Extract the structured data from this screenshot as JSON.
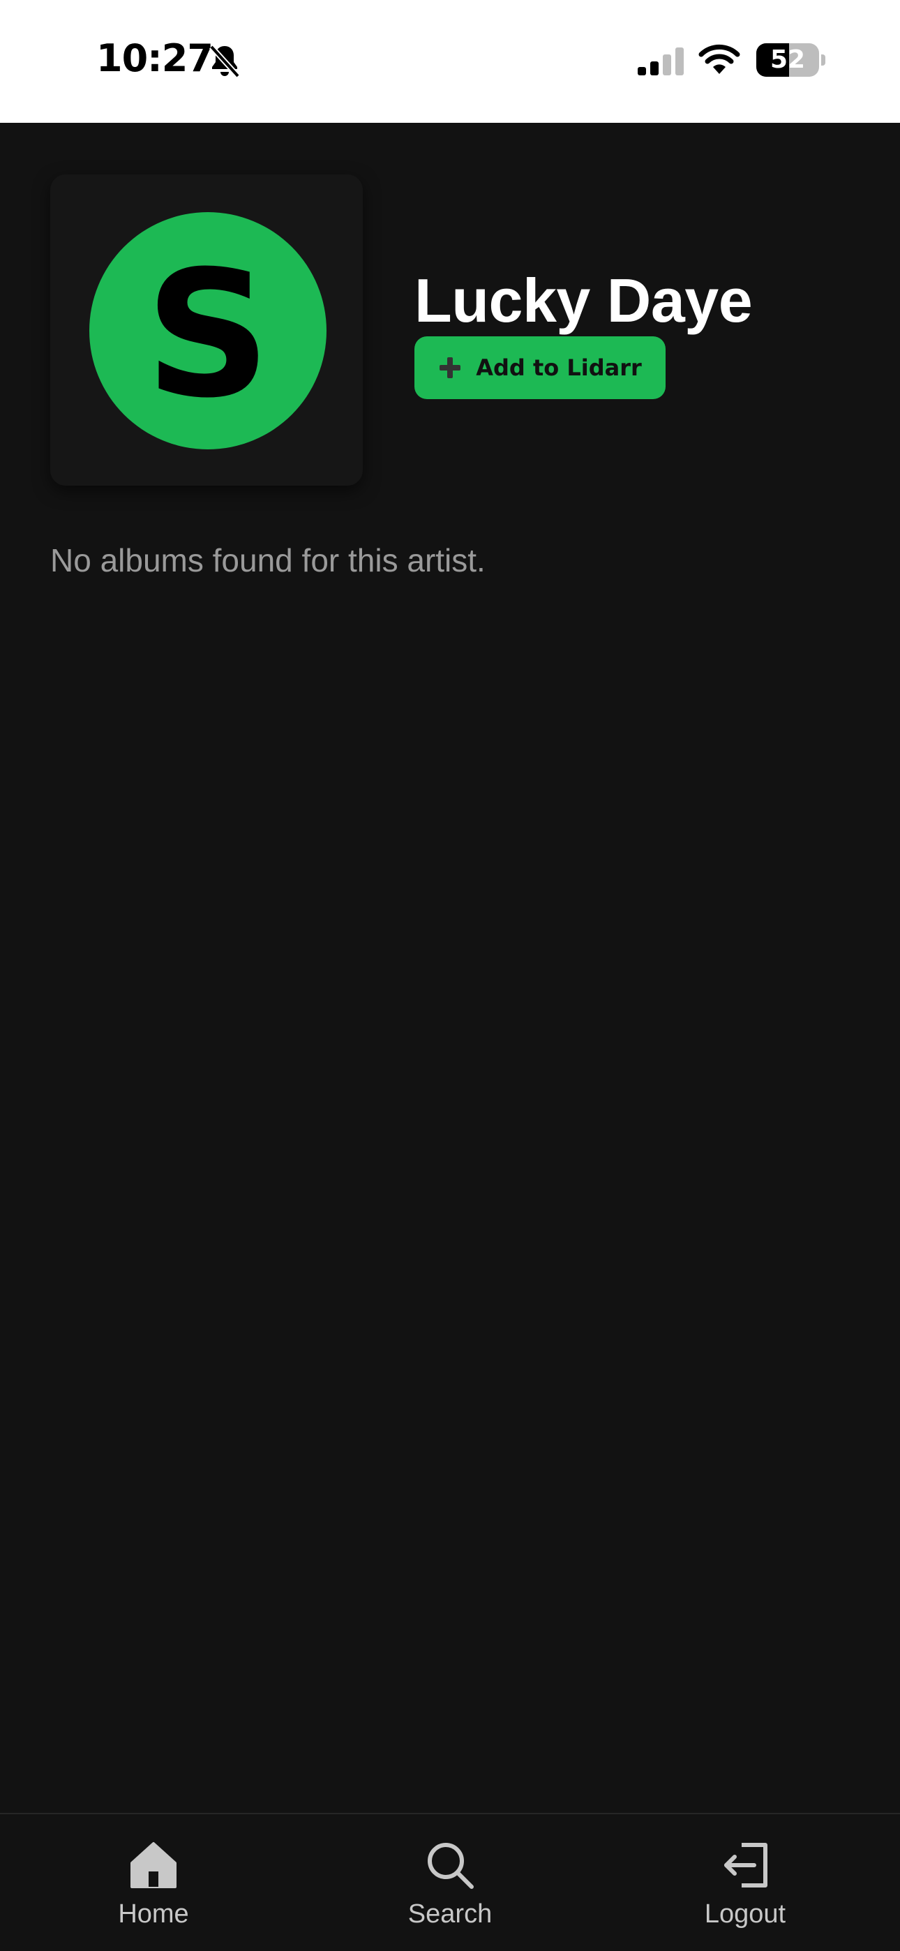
{
  "status_bar": {
    "time": "10:27",
    "battery_level": "52",
    "battery_fraction": 0.52,
    "icons": [
      "bell-slash-icon",
      "signal-icon",
      "wifi-icon",
      "battery-icon"
    ]
  },
  "artist": {
    "name": "Lucky Daye",
    "logo_letter": "S",
    "logo_icon": "spotify-s-logo",
    "add_button_label": "Add to Lidarr",
    "add_button_icon": "plus-icon"
  },
  "albums": {
    "empty_message": "No albums found for this artist."
  },
  "bottom_nav": {
    "items": [
      {
        "label": "Home",
        "icon": "home-icon"
      },
      {
        "label": "Search",
        "icon": "search-icon"
      },
      {
        "label": "Logout",
        "icon": "logout-icon"
      }
    ]
  },
  "colors": {
    "accent": "#1db954",
    "background": "#121212",
    "card": "#161616",
    "muted_text": "#9a9a9a",
    "nav_text": "#c8c8c8"
  }
}
